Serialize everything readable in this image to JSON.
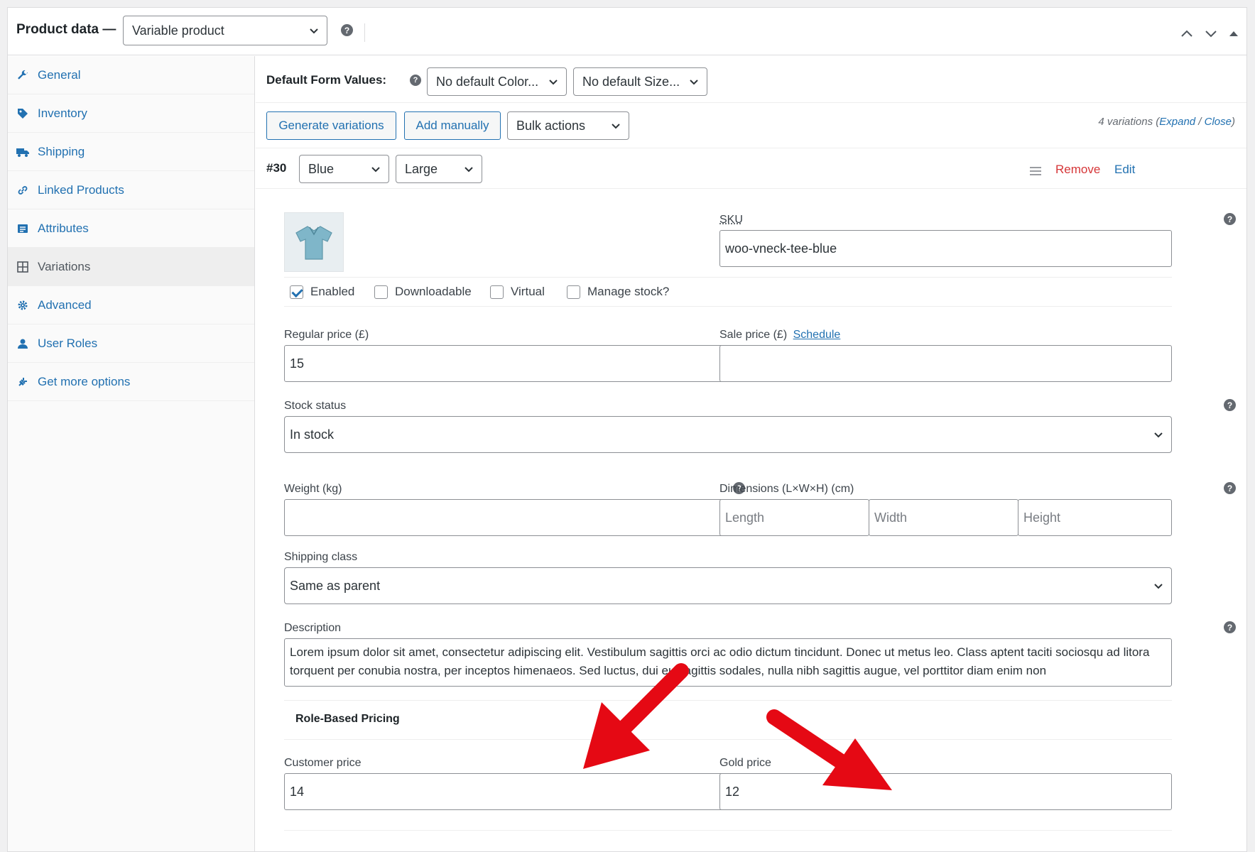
{
  "header": {
    "title": "Product data —",
    "product_type": "Variable product"
  },
  "sidebar": {
    "items": [
      {
        "label": "General",
        "icon": "wrench-icon"
      },
      {
        "label": "Inventory",
        "icon": "tag-icon"
      },
      {
        "label": "Shipping",
        "icon": "truck-icon"
      },
      {
        "label": "Linked Products",
        "icon": "link-icon"
      },
      {
        "label": "Attributes",
        "icon": "list-icon"
      },
      {
        "label": "Variations",
        "icon": "grid-icon"
      },
      {
        "label": "Advanced",
        "icon": "gear-icon"
      },
      {
        "label": "User Roles",
        "icon": "user-icon"
      },
      {
        "label": "Get more options",
        "icon": "plugin-icon"
      }
    ]
  },
  "defaults": {
    "label": "Default Form Values:",
    "color": "No default Color...",
    "size": "No default Size..."
  },
  "actions": {
    "generate": "Generate variations",
    "add_manually": "Add manually",
    "bulk": "Bulk actions",
    "count_text": "4 variations (",
    "expand": "Expand",
    "slash": " / ",
    "close": "Close",
    "close_paren": ")"
  },
  "variation": {
    "number": "#30",
    "color": "Blue",
    "size": "Large",
    "remove": "Remove",
    "edit": "Edit",
    "sku_label": "SKU",
    "sku": "woo-vneck-tee-blue",
    "enabled": "Enabled",
    "downloadable": "Downloadable",
    "virtual": "Virtual",
    "manage_stock": "Manage stock?",
    "regular_price_label": "Regular price (£)",
    "regular_price": "15",
    "sale_price_label": "Sale price (£)",
    "schedule": "Schedule",
    "sale_price": "",
    "stock_status_label": "Stock status",
    "stock_status": "In stock",
    "weight_label": "Weight (kg)",
    "weight": "",
    "dimensions_label": "Dimensions (L×W×H) (cm)",
    "length_ph": "Length",
    "width_ph": "Width",
    "height_ph": "Height",
    "shipping_class_label": "Shipping class",
    "shipping_class": "Same as parent",
    "description_label": "Description",
    "description": "Lorem ipsum dolor sit amet, consectetur adipiscing elit. Vestibulum sagittis orci ac odio dictum tincidunt. Donec ut metus leo. Class aptent taciti sociosqu ad litora torquent per conubia nostra, per inceptos himenaeos. Sed luctus, dui eu sagittis sodales, nulla nibh sagittis augue, vel porttitor diam enim non",
    "role_pricing_title": "Role-Based Pricing",
    "customer_price_label": "Customer price",
    "customer_price": "14",
    "gold_price_label": "Gold price",
    "gold_price": "12"
  },
  "colors": {
    "link": "#2271b1",
    "remove": "#d63638",
    "annotation_arrow": "#e50914"
  }
}
